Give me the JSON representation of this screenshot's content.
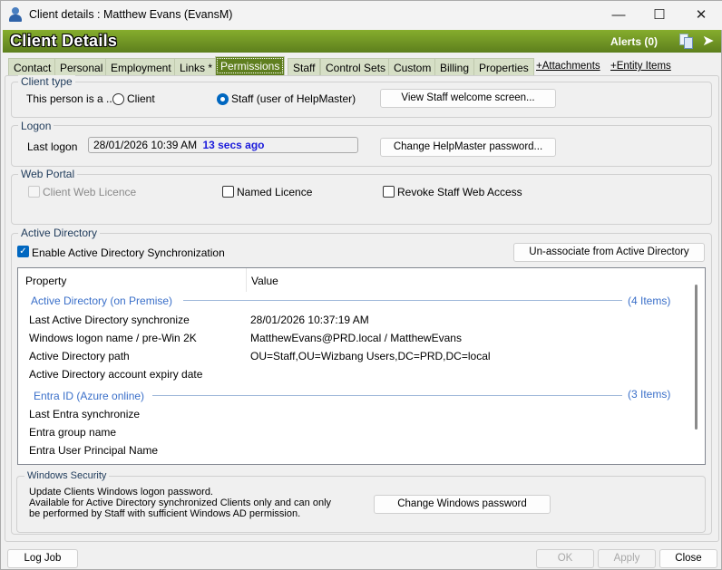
{
  "window": {
    "title": "Client details : Matthew Evans  (EvansM)",
    "minimize": "—",
    "maximize": "☐",
    "close": "✕"
  },
  "header": {
    "title": "Client Details",
    "alerts": "Alerts (0)"
  },
  "tabs": [
    {
      "label": "Contact"
    },
    {
      "label": "Personal"
    },
    {
      "label": "Employment"
    },
    {
      "label": "Links *"
    },
    {
      "label": "Permissions",
      "active": true
    },
    {
      "label": "Staff"
    },
    {
      "label": "Control Sets"
    },
    {
      "label": "Custom"
    },
    {
      "label": "Billing"
    },
    {
      "label": "Properties"
    }
  ],
  "link_tabs": [
    "+Attachments",
    "+Entity Items"
  ],
  "client_type": {
    "label": "Client type",
    "prompt": "This person is a ..",
    "options": [
      {
        "label": "Client",
        "selected": false
      },
      {
        "label": "Staff (user of HelpMaster)",
        "selected": true
      }
    ],
    "button": "View Staff welcome screen..."
  },
  "logon": {
    "label": "Logon",
    "field_label": "Last logon",
    "value": "28/01/2026 10:39 AM",
    "ago": "13 secs ago",
    "button": "Change HelpMaster password..."
  },
  "web_portal": {
    "label": "Web Portal",
    "client_web_licence": "Client Web Licence",
    "named_licence": "Named Licence",
    "revoke": "Revoke Staff Web Access"
  },
  "active_directory": {
    "label": "Active Directory",
    "enable_sync": "Enable Active Directory Synchronization",
    "enable_sync_checked": true,
    "unassociate": "Un-associate from Active Directory",
    "columns": [
      "Property",
      "Value"
    ],
    "groups": [
      {
        "title": "Active Directory (on Premise)",
        "count": "(4 Items)",
        "rows": [
          {
            "property": "Last Active Directory synchronize",
            "value": "28/01/2026 10:37:19 AM"
          },
          {
            "property": "Windows logon name / pre-Win 2K",
            "value": "MatthewEvans@PRD.local / MatthewEvans"
          },
          {
            "property": "Active Directory path",
            "value": "OU=Staff,OU=Wizbang Users,DC=PRD,DC=local"
          },
          {
            "property": "Active Directory account expiry date",
            "value": ""
          }
        ]
      },
      {
        "title": "Entra ID (Azure online)",
        "count": "(3 Items)",
        "rows": [
          {
            "property": "Last Entra synchronize",
            "value": ""
          },
          {
            "property": "Entra group name",
            "value": ""
          },
          {
            "property": "Entra User Principal Name",
            "value": ""
          }
        ]
      }
    ]
  },
  "windows_security": {
    "label": "Windows Security",
    "line1": "Update Clients Windows logon password.",
    "line2": "Available for Active Directory synchronized Clients only and can only",
    "line3": "be performed by Staff with sufficient Windows AD permission.",
    "button": "Change Windows password"
  },
  "footer": {
    "log_job": "Log Job",
    "ok": "OK",
    "apply": "Apply",
    "close": "Close"
  },
  "colors": {
    "header_green": "#6b8f22",
    "accent": "#0067c0",
    "group_text": "#3a6fc9",
    "ago_text": "#1a1adb"
  }
}
